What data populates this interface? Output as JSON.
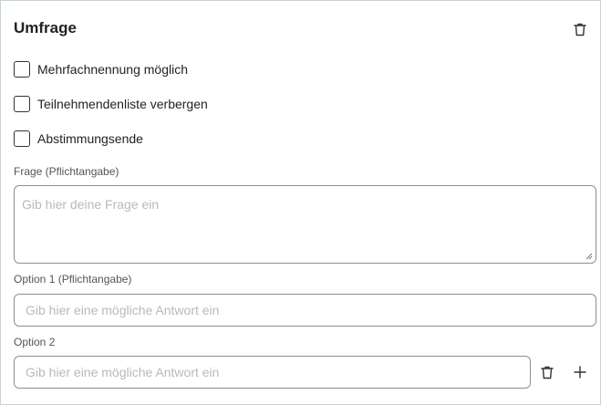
{
  "panel": {
    "title": "Umfrage",
    "delete_icon": "trash-icon"
  },
  "options": [
    {
      "label": "Mehrfachnennung möglich",
      "checked": false
    },
    {
      "label": "Teilnehmendenliste verbergen",
      "checked": false
    },
    {
      "label": "Abstimmungsende",
      "checked": false
    }
  ],
  "question": {
    "label": "Frage (Pflichtangabe)",
    "placeholder": "Gib hier deine Frage ein",
    "value": ""
  },
  "answers": [
    {
      "label": "Option 1 (Pflichtangabe)",
      "placeholder": "Gib hier eine mögliche Antwort ein",
      "value": ""
    },
    {
      "label": "Option 2",
      "placeholder": "Gib hier eine mögliche Antwort ein",
      "value": "",
      "remove_icon": "trash-icon",
      "add_icon": "plus-icon"
    }
  ]
}
